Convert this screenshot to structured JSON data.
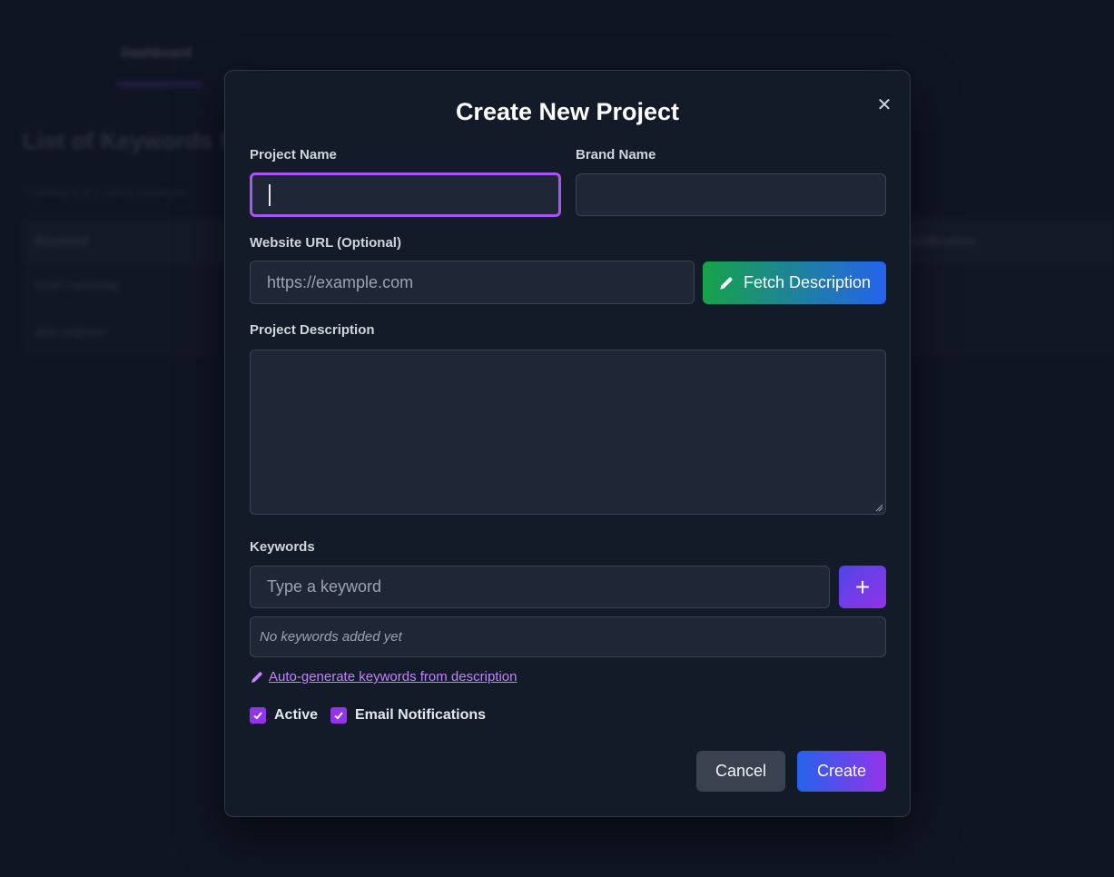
{
  "background": {
    "nav_label": "Dashboard",
    "page_title": "List of Keywords for",
    "subtitle": "Tracking 0 of 2 active keywords",
    "table_headers": [
      "Keyword",
      "Notification"
    ],
    "rows": [
      "email marketing",
      "data engineer"
    ]
  },
  "modal": {
    "title": "Create New Project",
    "close_glyph": "✕",
    "project_name": {
      "label": "Project Name",
      "value": ""
    },
    "brand_name": {
      "label": "Brand Name",
      "value": ""
    },
    "website_url": {
      "label": "Website URL (Optional)",
      "placeholder": "https://example.com"
    },
    "fetch_button": {
      "label": "Fetch Description",
      "icon": "pencil-icon"
    },
    "description": {
      "label": "Project Description",
      "value": ""
    },
    "keywords": {
      "label": "Keywords",
      "placeholder": "Type a keyword",
      "add_glyph": "+",
      "empty_text": "No keywords added yet",
      "autogen_link": "Auto-generate keywords from description"
    },
    "checkboxes": [
      {
        "label": "Active",
        "checked": true
      },
      {
        "label": "Email Notifications",
        "checked": true
      }
    ],
    "buttons": {
      "cancel": "Cancel",
      "create": "Create"
    }
  },
  "colors": {
    "accent_purple": "#a855f7",
    "checkbox": "#9333ea",
    "fetch_gradient": [
      "#16a34a",
      "#2563eb"
    ],
    "create_gradient": [
      "#2563eb",
      "#9333ea"
    ]
  }
}
